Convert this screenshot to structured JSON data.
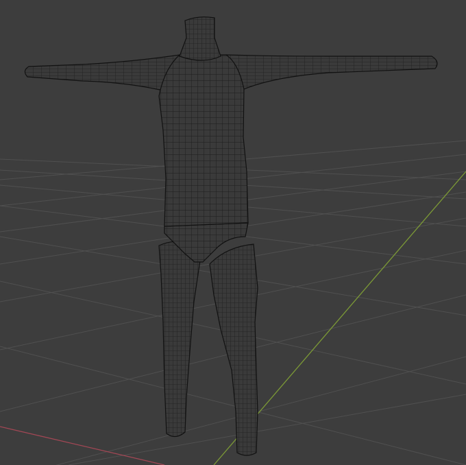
{
  "viewport": {
    "background": "#3d3d3d",
    "grid_color": "#505050",
    "x_axis_color": "#a34755",
    "y_axis_color": "#7c9a36",
    "mesh_fill": "#3a3a3a",
    "mesh_wire": "#1c1c1c",
    "mesh_edge": "#111111"
  },
  "scene": {
    "object": "humanoid-base-mesh",
    "display_mode": "wireframe-over-solid",
    "pose": "T-pose",
    "parts": [
      "neck",
      "torso",
      "left-arm",
      "right-arm",
      "pelvis",
      "left-leg",
      "right-leg"
    ]
  }
}
